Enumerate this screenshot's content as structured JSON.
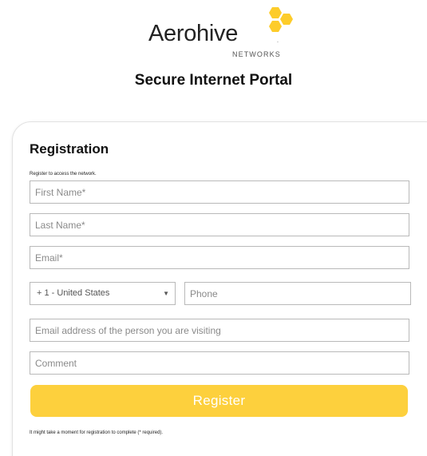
{
  "header": {
    "brand_name": "Aerohive",
    "brand_mark": ".",
    "brand_sub": "NETWORKS",
    "portal_title": "Secure Internet Portal",
    "logo_color": "#fdcc2a"
  },
  "form": {
    "title": "Registration",
    "subtitle": "Register to access the network.",
    "first_name_placeholder": "First Name*",
    "last_name_placeholder": "Last Name*",
    "email_placeholder": "Email*",
    "country_selected": "+ 1 - United States",
    "country_caret": "▼",
    "phone_placeholder": "Phone",
    "visiting_placeholder": "Email address of the person you are visiting",
    "comment_placeholder": "Comment",
    "register_label": "Register",
    "footer_note": "It might take a moment for registration to complete (* required).",
    "button_color": "#fdd03d"
  }
}
